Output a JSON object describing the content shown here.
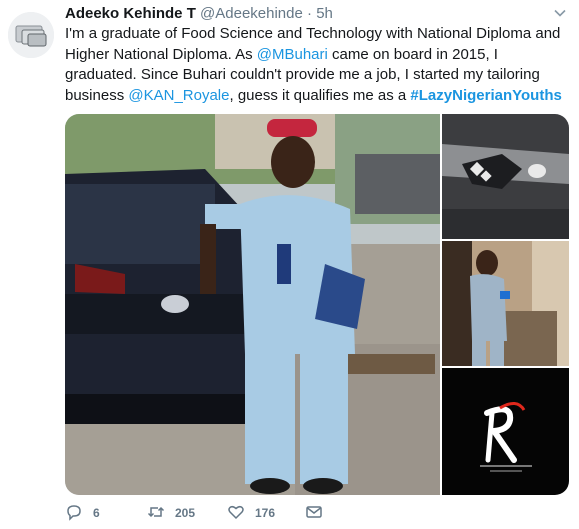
{
  "tweet": {
    "display_name": "Adeeko Kehinde T",
    "handle": "@Adeekehinde",
    "separator": "·",
    "time": "5h",
    "text_1": "I'm a graduate of Food Science and Technology with National Diploma and Higher National Diploma. As ",
    "mention_1": "@MBuhari",
    "text_2": " came on board in 2015, I graduated. Since Buhari couldn't provide me a job, I started my tailoring business ",
    "mention_2": "@KAN_Royale",
    "text_3": ", guess it qualifies me as a ",
    "hashtag": "#LazyNigerianYouths"
  },
  "actions": {
    "replies": "6",
    "retweets": "205",
    "likes": "176"
  },
  "colors": {
    "link": "#1b95e0",
    "secondary_text": "#657786",
    "primary_text": "#14171a"
  },
  "icons": [
    "reply-icon",
    "retweet-icon",
    "like-icon",
    "message-icon",
    "chevron-down-icon"
  ]
}
